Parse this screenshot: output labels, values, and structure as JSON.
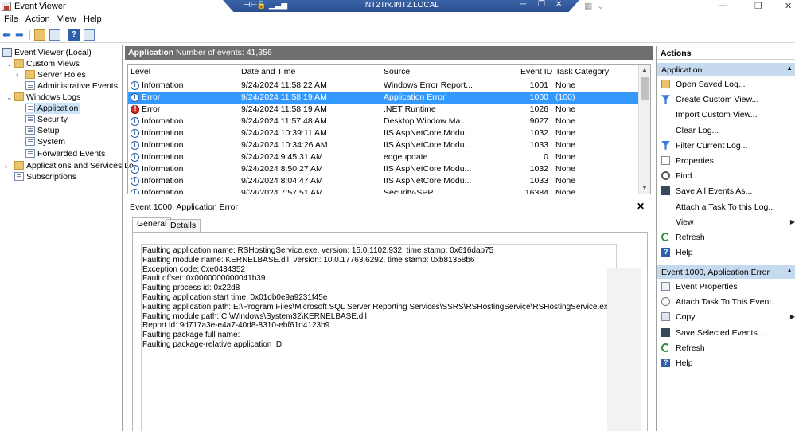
{
  "window": {
    "title": "Event Viewer",
    "rdp_host": "INT2Trx.INT2.LOCAL"
  },
  "menu": [
    "File",
    "Action",
    "View",
    "Help"
  ],
  "tree": {
    "items": [
      {
        "label": "Event Viewer (Local)"
      },
      {
        "label": "Custom Views"
      },
      {
        "label": "Server Roles"
      },
      {
        "label": "Administrative Events"
      },
      {
        "label": "Windows Logs"
      },
      {
        "label": "Application"
      },
      {
        "label": "Security"
      },
      {
        "label": "Setup"
      },
      {
        "label": "System"
      },
      {
        "label": "Forwarded Events"
      },
      {
        "label": "Applications and Services Lo"
      },
      {
        "label": "Subscriptions"
      }
    ]
  },
  "center": {
    "log_name": "Application",
    "count_label": "Number of events: 41,356"
  },
  "table": {
    "columns": [
      "Level",
      "Date and Time",
      "Source",
      "Event ID",
      "Task Category"
    ],
    "rows": [
      {
        "level": "Information",
        "datetime": "9/24/2024 11:58:22 AM",
        "source": "Windows Error Report...",
        "event_id": "1001",
        "task": "None"
      },
      {
        "level": "Error",
        "datetime": "9/24/2024 11:58:19 AM",
        "source": "Application Error",
        "event_id": "1000",
        "task": "(100)"
      },
      {
        "level": "Error",
        "datetime": "9/24/2024 11:58:19 AM",
        "source": ".NET Runtime",
        "event_id": "1026",
        "task": "None"
      },
      {
        "level": "Information",
        "datetime": "9/24/2024 11:57:48 AM",
        "source": "Desktop Window Ma...",
        "event_id": "9027",
        "task": "None"
      },
      {
        "level": "Information",
        "datetime": "9/24/2024 10:39:11 AM",
        "source": "IIS AspNetCore Modu...",
        "event_id": "1032",
        "task": "None"
      },
      {
        "level": "Information",
        "datetime": "9/24/2024 10:34:26 AM",
        "source": "IIS AspNetCore Modu...",
        "event_id": "1033",
        "task": "None"
      },
      {
        "level": "Information",
        "datetime": "9/24/2024 9:45:31 AM",
        "source": "edgeupdate",
        "event_id": "0",
        "task": "None"
      },
      {
        "level": "Information",
        "datetime": "9/24/2024 8:50:27 AM",
        "source": "IIS AspNetCore Modu...",
        "event_id": "1032",
        "task": "None"
      },
      {
        "level": "Information",
        "datetime": "9/24/2024 8:04:47 AM",
        "source": "IIS AspNetCore Modu...",
        "event_id": "1033",
        "task": "None"
      },
      {
        "level": "Information",
        "datetime": "9/24/2024 7:57:51 AM",
        "source": "Security-SPP",
        "event_id": "16384",
        "task": "None"
      }
    ]
  },
  "details": {
    "title": "Event 1000, Application Error",
    "tabs": [
      "General",
      "Details"
    ],
    "lines": [
      "Faulting application name: RSHostingService.exe, version: 15.0.1102.932, time stamp: 0x616dab75",
      "Faulting module name: KERNELBASE.dll, version: 10.0.17763.6292, time stamp: 0xb81358b6",
      "Exception code: 0xe0434352",
      "Fault offset: 0x0000000000041b39",
      "Faulting process id: 0x22d8",
      "Faulting application start time: 0x01db0e9a9231f45e",
      "Faulting application path: E:\\Program Files\\Microsoft SQL Server Reporting Services\\SSRS\\RSHostingService\\RSHostingService.exe",
      "Faulting module path: C:\\Windows\\System32\\KERNELBASE.dll",
      "Report Id: 9d717a3e-e4a7-40d8-8310-ebf61d4123b9",
      "Faulting package full name:",
      "Faulting package-relative application ID:"
    ]
  },
  "actions": {
    "title": "Actions",
    "section1": "Application",
    "items1": [
      "Open Saved Log...",
      "Create Custom View...",
      "Import Custom View...",
      "Clear Log...",
      "Filter Current Log...",
      "Properties",
      "Find...",
      "Save All Events As...",
      "Attach a Task To this Log...",
      "View",
      "Refresh",
      "Help"
    ],
    "section2": "Event 1000, Application Error",
    "items2": [
      "Event Properties",
      "Attach Task To This Event...",
      "Copy",
      "Save Selected Events...",
      "Refresh",
      "Help"
    ]
  }
}
